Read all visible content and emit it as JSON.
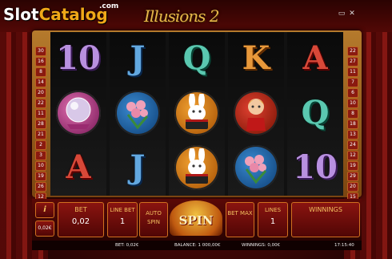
{
  "watermark": {
    "brand_a": "Slot",
    "brand_b": "Catalog",
    "suffix": ".com"
  },
  "title": "Illusions 2",
  "window": {
    "min_icon": "minimize-icon",
    "close_icon": "close-icon"
  },
  "left_lines": [
    "30",
    "16",
    "8",
    "14",
    "20",
    "22",
    "11",
    "28",
    "21",
    "2",
    "3",
    "10",
    "19",
    "26",
    "12",
    "27"
  ],
  "right_lines": [
    "22",
    "27",
    "11",
    "7",
    "6",
    "10",
    "8",
    "18",
    "13",
    "24",
    "12",
    "19",
    "29",
    "20",
    "15",
    "17"
  ],
  "reels": [
    [
      {
        "kind": "text",
        "value": "10",
        "color": "c-purple"
      },
      {
        "kind": "icon",
        "icon": "crystal-ball-icon",
        "disc": "disc-pink"
      },
      {
        "kind": "text",
        "value": "A",
        "color": "c-red"
      }
    ],
    [
      {
        "kind": "text",
        "value": "J",
        "color": "c-blue"
      },
      {
        "kind": "icon",
        "icon": "flower-bouquet-icon",
        "disc": "disc-blue"
      },
      {
        "kind": "text",
        "value": "J",
        "color": "c-blue"
      }
    ],
    [
      {
        "kind": "text",
        "value": "Q",
        "color": "c-teal"
      },
      {
        "kind": "icon",
        "icon": "rabbit-in-hat-icon",
        "disc": "disc-orange"
      },
      {
        "kind": "icon",
        "icon": "rabbit-in-hat-icon",
        "disc": "disc-orange"
      }
    ],
    [
      {
        "kind": "text",
        "value": "K",
        "color": "c-orange"
      },
      {
        "kind": "icon",
        "icon": "magician-assistant-icon",
        "disc": "disc-red"
      },
      {
        "kind": "icon",
        "icon": "flower-bouquet-icon",
        "disc": "disc-blue"
      }
    ],
    [
      {
        "kind": "text",
        "value": "A",
        "color": "c-red"
      },
      {
        "kind": "text",
        "value": "Q",
        "color": "c-teal"
      },
      {
        "kind": "text",
        "value": "10",
        "color": "c-purple"
      }
    ]
  ],
  "controls": {
    "info": "i",
    "coin": "0,02€",
    "bet_label": "BET",
    "bet_value": "0,02",
    "line_bet_label": "LINE BET",
    "line_bet_value": "1",
    "auto_spin_label": "AUTO SPIN",
    "spin_label": "SPIN",
    "bet_max_label": "BET MAX",
    "lines_label": "LINES",
    "lines_value": "1",
    "winnings_label": "WINNINGS"
  },
  "status": {
    "bet": "BET: 0,02€",
    "balance": "BALANCE: 1 000,00€",
    "winnings": "WINNINGS: 0,00€",
    "time": "17:15:40"
  }
}
